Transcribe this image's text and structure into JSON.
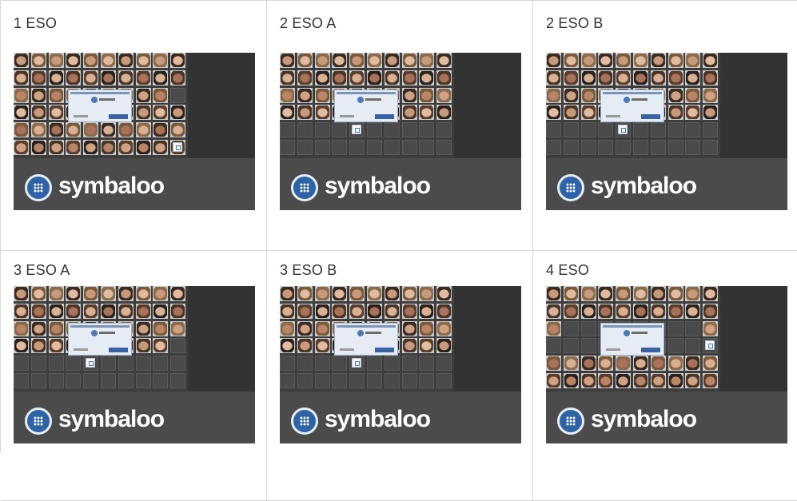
{
  "groups": [
    {
      "label": "1 ESO",
      "brand": "symbaloo",
      "rows": [
        "1111111111",
        "1111111111",
        "1111111110",
        "1111111111",
        "1111111111",
        "1111111111"
      ],
      "popup": true,
      "mini": [
        9,
        5
      ]
    },
    {
      "label": "2 ESO A",
      "brand": "symbaloo",
      "rows": [
        "1111111111",
        "1111111111",
        "1111111111",
        "1111111111",
        "0000000000",
        "0000000000"
      ],
      "popup": true,
      "mini": [
        4,
        4
      ]
    },
    {
      "label": "2 ESO B",
      "brand": "symbaloo",
      "rows": [
        "1111111111",
        "1111111111",
        "1111111111",
        "1111111111",
        "0000000000",
        "0000000000"
      ],
      "popup": true,
      "mini": [
        4,
        4
      ]
    },
    {
      "label": "3 ESO A",
      "brand": "symbaloo",
      "rows": [
        "1111111111",
        "1111111111",
        "1111111111",
        "1111111110",
        "0000000000",
        "0000000000"
      ],
      "popup": true,
      "mini": [
        4,
        4
      ]
    },
    {
      "label": "3 ESO B",
      "brand": "symbaloo",
      "rows": [
        "1111111111",
        "1111111111",
        "1111111111",
        "1111111111",
        "0000000000",
        "0000000000"
      ],
      "popup": true,
      "mini": [
        4,
        4
      ]
    },
    {
      "label": "4 ESO",
      "brand": "symbaloo",
      "rows": [
        "1111111111",
        "1111111111",
        "1000000001",
        "0000000000",
        "1111111111",
        "1111111111"
      ],
      "popup": true,
      "mini": [
        9,
        3
      ]
    }
  ]
}
